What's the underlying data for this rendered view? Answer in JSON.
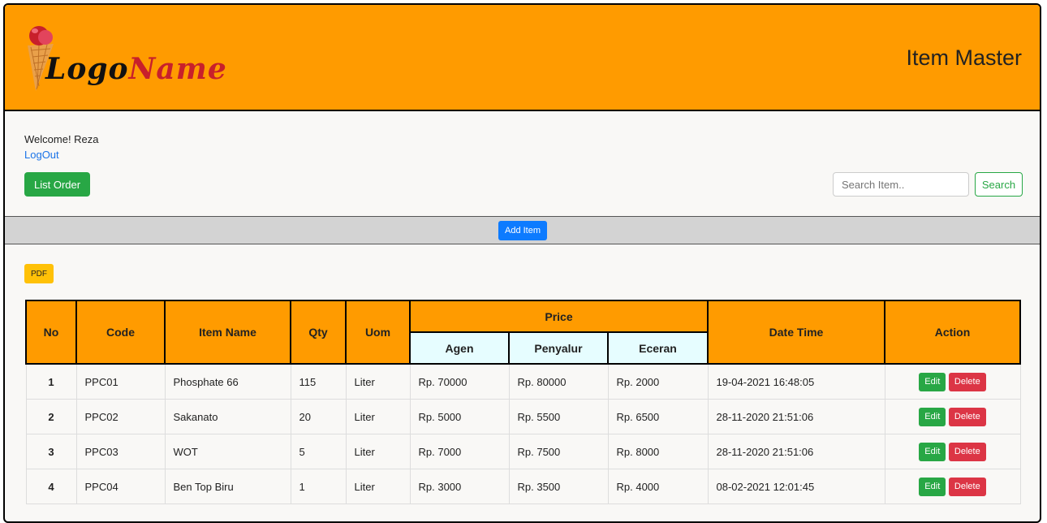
{
  "header": {
    "logo_part1": "Logo",
    "logo_part2": "Name",
    "title": "Item Master"
  },
  "user": {
    "welcome": "Welcome! Reza",
    "logout": "LogOut"
  },
  "toolbar": {
    "list_order": "List Order",
    "search_placeholder": "Search Item..",
    "search": "Search",
    "add_item": "Add Item",
    "pdf": "PDF"
  },
  "table": {
    "headers": {
      "no": "No",
      "code": "Code",
      "item_name": "Item Name",
      "qty": "Qty",
      "uom": "Uom",
      "price": "Price",
      "agen": "Agen",
      "penyalur": "Penyalur",
      "eceran": "Eceran",
      "date_time": "Date Time",
      "action": "Action"
    },
    "edit_label": "Edit",
    "delete_label": "Delete",
    "rows": [
      {
        "no": "1",
        "code": "PPC01",
        "name": "Phosphate 66",
        "qty": "115",
        "uom": "Liter",
        "agen": "Rp. 70000",
        "penyalur": "Rp. 80000",
        "eceran": "Rp. 2000",
        "datetime": "19-04-2021 16:48:05"
      },
      {
        "no": "2",
        "code": "PPC02",
        "name": "Sakanato",
        "qty": "20",
        "uom": "Liter",
        "agen": "Rp. 5000",
        "penyalur": "Rp. 5500",
        "eceran": "Rp. 6500",
        "datetime": "28-11-2020 21:51:06"
      },
      {
        "no": "3",
        "code": "PPC03",
        "name": "WOT",
        "qty": "5",
        "uom": "Liter",
        "agen": "Rp. 7000",
        "penyalur": "Rp. 7500",
        "eceran": "Rp. 8000",
        "datetime": "28-11-2020 21:51:06"
      },
      {
        "no": "4",
        "code": "PPC04",
        "name": "Ben Top Biru",
        "qty": "1",
        "uom": "Liter",
        "agen": "Rp. 3000",
        "penyalur": "Rp. 3500",
        "eceran": "Rp. 4000",
        "datetime": "08-02-2021 12:01:45"
      }
    ]
  },
  "colors": {
    "header_bg": "#ff9b00",
    "price_sub_bg": "#e6fdff",
    "success": "#28a745",
    "danger": "#dc3545",
    "primary": "#0d7bff",
    "warning": "#ffc107"
  },
  "icons": {
    "logo": "ice-cream-cone-logo"
  }
}
